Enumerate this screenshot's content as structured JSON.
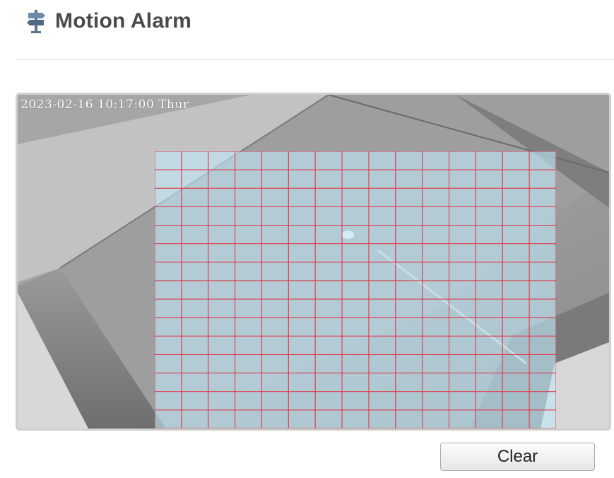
{
  "header": {
    "title": "Motion Alarm",
    "icon": "signpost-icon"
  },
  "video": {
    "timestamp": "2023-02-16 10:17:00 Thur"
  },
  "motion_grid": {
    "columns": 15,
    "rows": 15,
    "all_selected": true,
    "line_color": "#e0394a",
    "fill_color": "#bfe6f5"
  },
  "actions": {
    "clear_label": "Clear"
  }
}
